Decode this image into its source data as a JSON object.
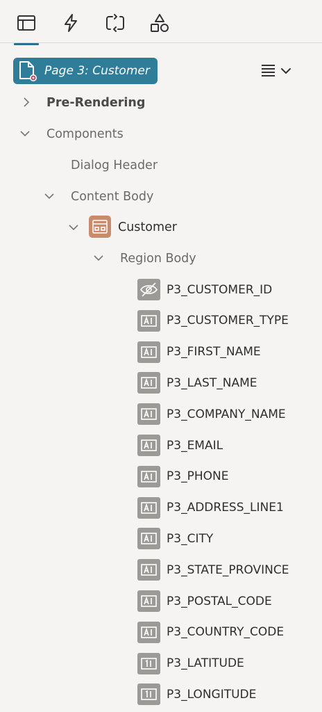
{
  "toolbar": {
    "tabs": [
      {
        "icon": "rendering-tree-icon",
        "active": true
      },
      {
        "icon": "dynamic-actions-icon",
        "active": false
      },
      {
        "icon": "processing-icon",
        "active": false
      },
      {
        "icon": "shared-components-icon",
        "active": false
      }
    ]
  },
  "page": {
    "label": "Page 3: Customer"
  },
  "tree": {
    "pre_rendering": "Pre-Rendering",
    "components": "Components",
    "dialog_header": "Dialog Header",
    "content_body": "Content Body",
    "region": "Customer",
    "region_body": "Region Body",
    "items": [
      {
        "name": "P3_CUSTOMER_ID",
        "type": "hidden"
      },
      {
        "name": "P3_CUSTOMER_TYPE",
        "type": "text"
      },
      {
        "name": "P3_FIRST_NAME",
        "type": "text"
      },
      {
        "name": "P3_LAST_NAME",
        "type": "text"
      },
      {
        "name": "P3_COMPANY_NAME",
        "type": "text"
      },
      {
        "name": "P3_EMAIL",
        "type": "text"
      },
      {
        "name": "P3_PHONE",
        "type": "text"
      },
      {
        "name": "P3_ADDRESS_LINE1",
        "type": "text"
      },
      {
        "name": "P3_CITY",
        "type": "text"
      },
      {
        "name": "P3_STATE_PROVINCE",
        "type": "text"
      },
      {
        "name": "P3_POSTAL_CODE",
        "type": "text"
      },
      {
        "name": "P3_COUNTRY_CODE",
        "type": "text"
      },
      {
        "name": "P3_LATITUDE",
        "type": "number"
      },
      {
        "name": "P3_LONGITUDE",
        "type": "number"
      }
    ]
  },
  "colors": {
    "accent": "#2f7d98",
    "region_icon": "#c98b6e",
    "item_icon": "#9c9a97",
    "background": "#f5f4f2"
  }
}
